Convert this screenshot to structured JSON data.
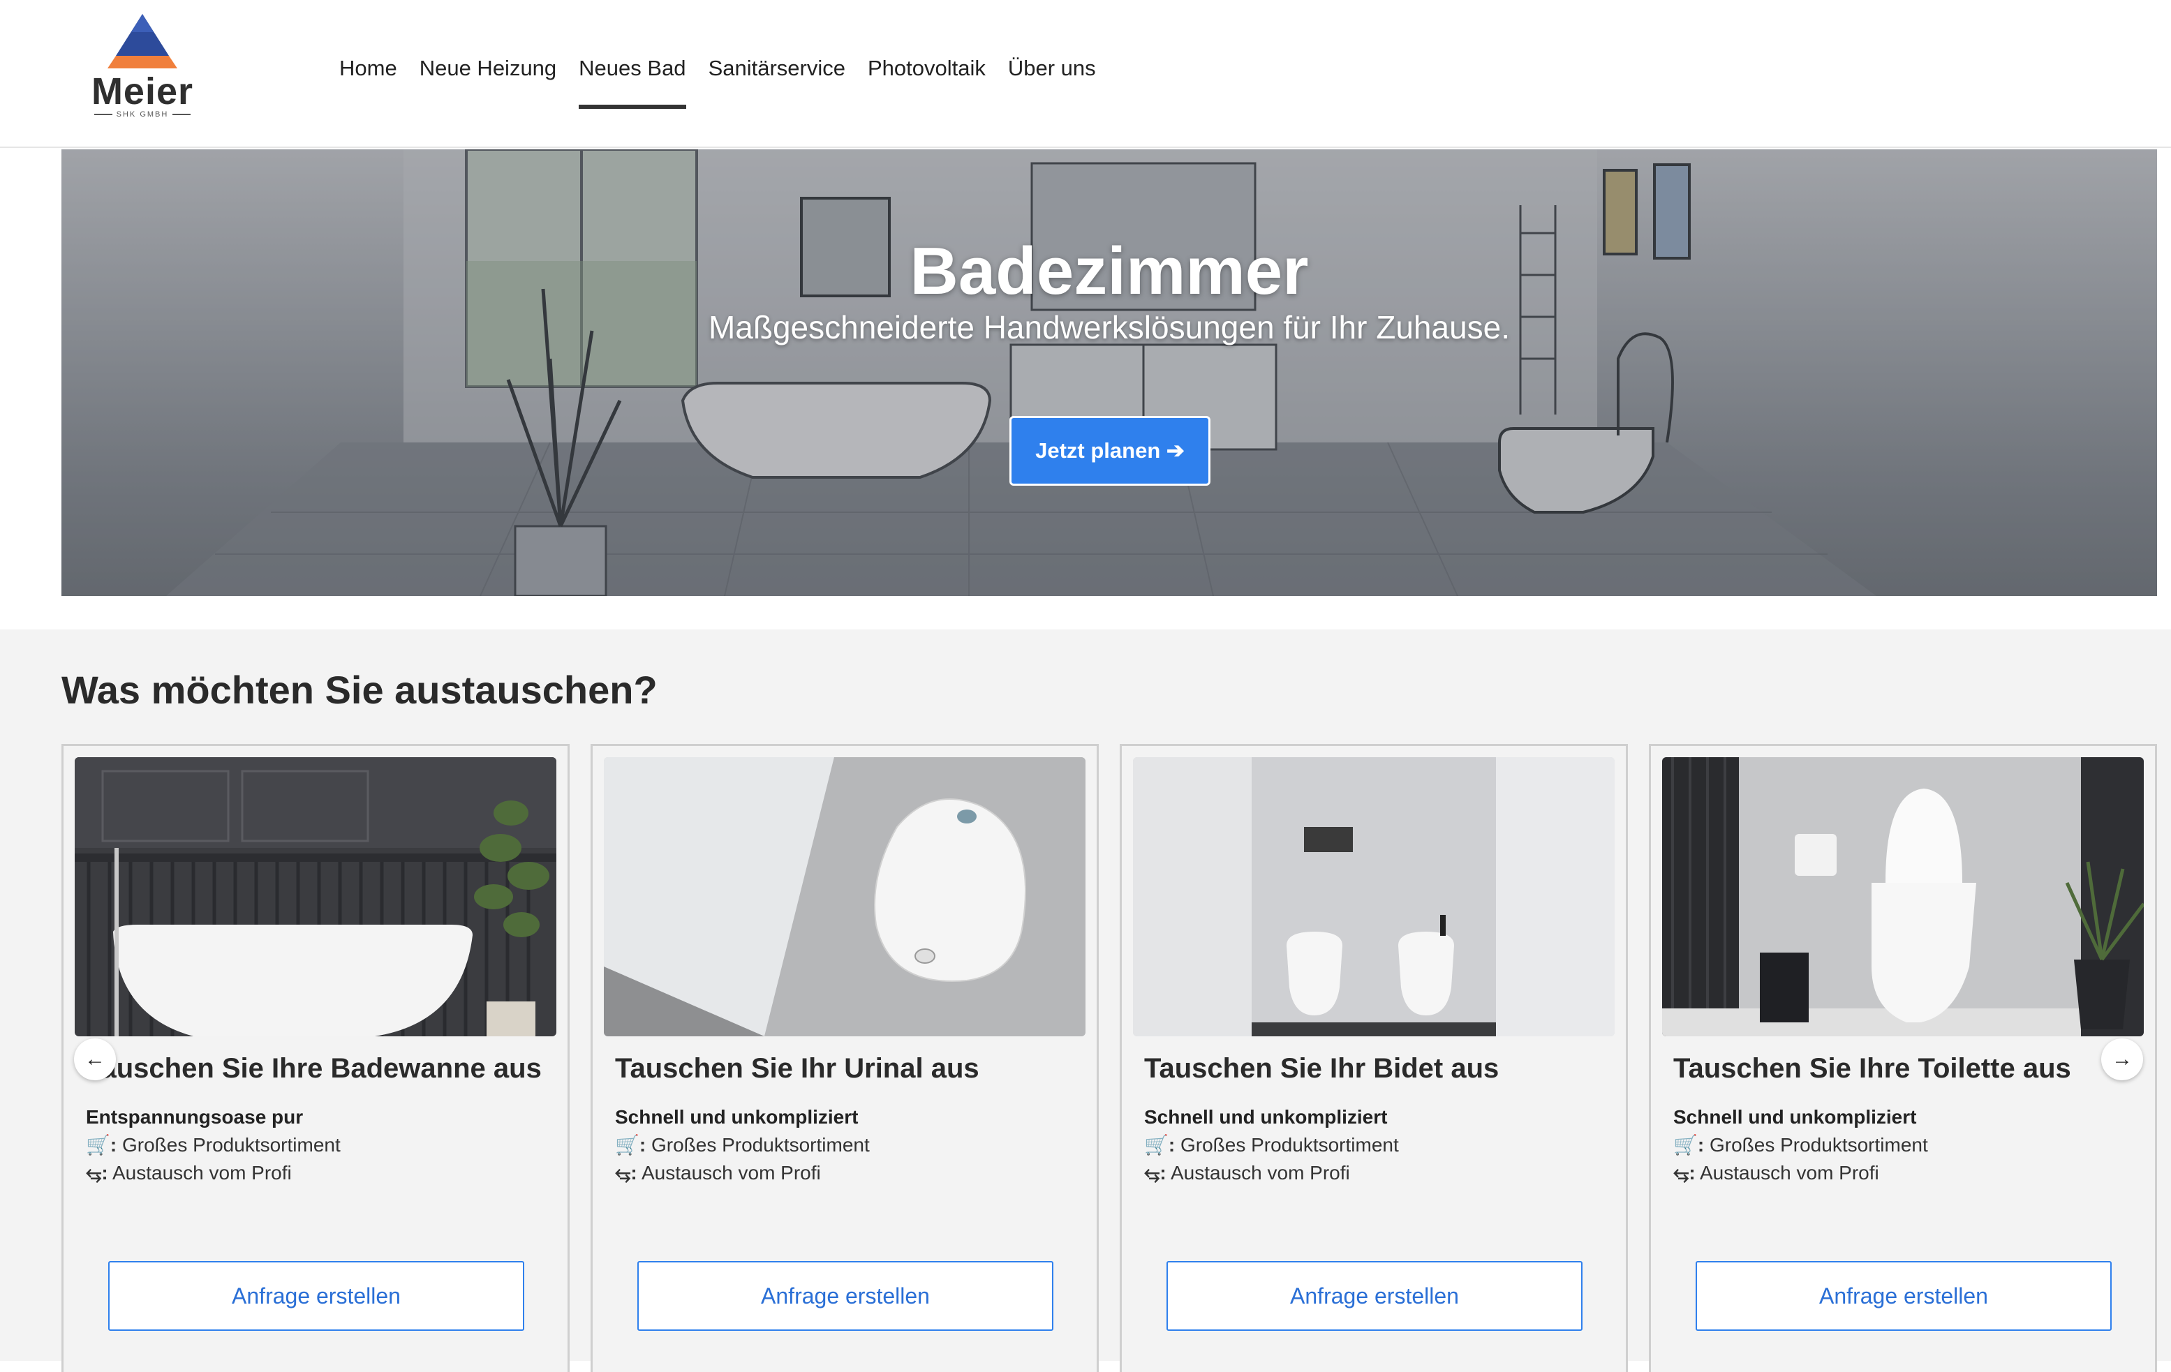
{
  "logo": {
    "name": "Meier",
    "sub": "SHK GMBH"
  },
  "nav": {
    "items": [
      {
        "label": "Home"
      },
      {
        "label": "Neue Heizung"
      },
      {
        "label": "Neues Bad"
      },
      {
        "label": "Sanitärservice"
      },
      {
        "label": "Photovoltaik"
      },
      {
        "label": "Über uns"
      }
    ],
    "active": "Neues Bad"
  },
  "hero": {
    "title": "Badezimmer",
    "subtitle": "Maßgeschneiderte Handwerkslösungen für Ihr Zuhause.",
    "button": "Jetzt planen ➔"
  },
  "section": {
    "title": "Was möchten Sie austauschen?",
    "cards": [
      {
        "title": "Tauschen Sie Ihre Badewanne aus",
        "tagline": "Entspannungsoase pur",
        "line1": "Großes Produktsortiment",
        "line2": "Austausch vom Profi",
        "button": "Anfrage erstellen"
      },
      {
        "title": "Tauschen Sie Ihr Urinal aus",
        "tagline": "Schnell und unkompliziert",
        "line1": "Großes Produktsortiment",
        "line2": "Austausch vom Profi",
        "button": "Anfrage erstellen"
      },
      {
        "title": "Tauschen Sie Ihr Bidet aus",
        "tagline": "Schnell und unkompliziert",
        "line1": "Großes Produktsortiment",
        "line2": "Austausch vom Profi",
        "button": "Anfrage erstellen"
      },
      {
        "title": "Tauschen Sie Ihre Toilette aus",
        "tagline": "Schnell und unkompliziert",
        "line1": "Großes Produktsortiment",
        "line2": "Austausch vom Profi",
        "button": "Anfrage erstellen"
      }
    ],
    "icons": {
      "cart": "🛒:",
      "swap": "⥃:"
    },
    "prev_arrow": "←",
    "next_arrow": "→"
  },
  "colors": {
    "accent": "#2f80ed",
    "logo_blue": "#2d4b9b",
    "logo_orange": "#f07f3c"
  }
}
